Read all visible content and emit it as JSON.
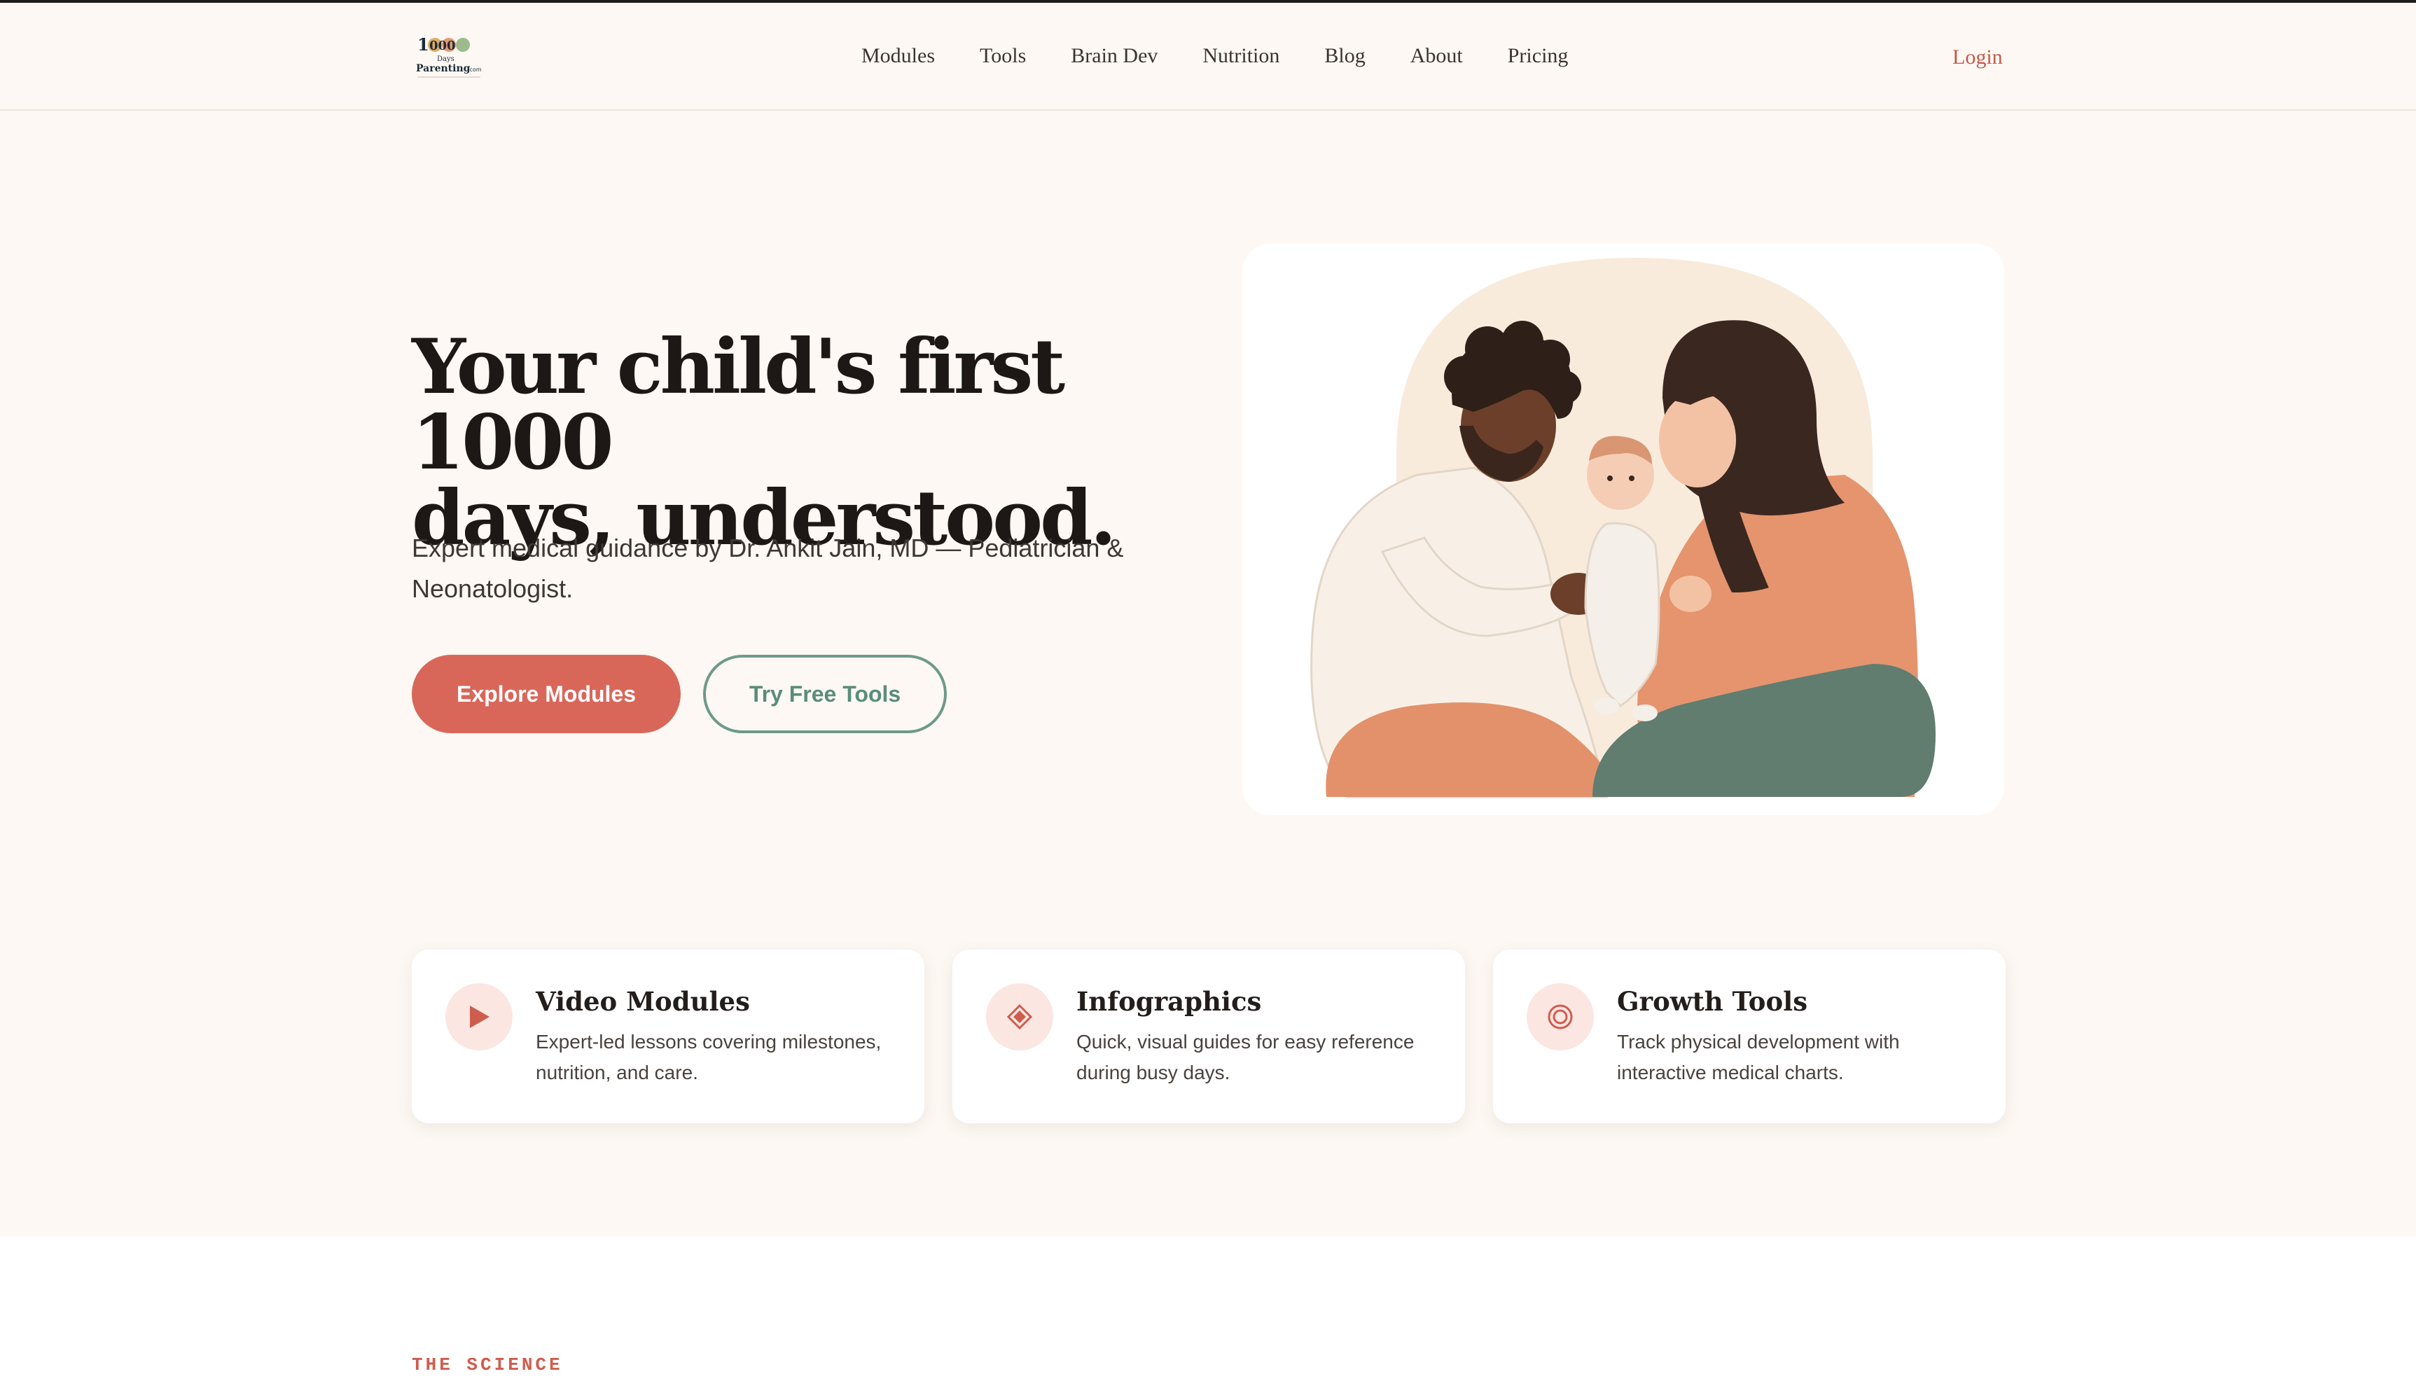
{
  "brand": {
    "logo_text_top": "1000",
    "logo_text_mid": "Days",
    "logo_text_bottom": "Parenting",
    "logo_suffix": ".com"
  },
  "nav": {
    "items": [
      {
        "label": "Modules"
      },
      {
        "label": "Tools"
      },
      {
        "label": "Brain Dev"
      },
      {
        "label": "Nutrition"
      },
      {
        "label": "Blog"
      },
      {
        "label": "About"
      },
      {
        "label": "Pricing"
      }
    ],
    "login_label": "Login"
  },
  "hero": {
    "title_line1": "Your child's first 1000",
    "title_line2": "days, understood.",
    "subtitle": "Expert medical guidance by Dr. Ankit Jain, MD — Pediatrician & Neonatologist.",
    "primary_cta": "Explore Modules",
    "secondary_cta": "Try Free Tools"
  },
  "features": [
    {
      "icon": "play-icon",
      "title": "Video Modules",
      "description": "Expert-led lessons covering milestones, nutrition, and care."
    },
    {
      "icon": "diamond-icon",
      "title": "Infographics",
      "description": "Quick, visual guides for easy reference during busy days."
    },
    {
      "icon": "target-icon",
      "title": "Growth Tools",
      "description": "Track physical development with interactive medical charts."
    }
  ],
  "science": {
    "eyebrow": "THE SCIENCE"
  },
  "colors": {
    "background": "#fdf8f3",
    "accent": "#d8675a",
    "secondary": "#6e9a8a",
    "text_dark": "#1d1816"
  }
}
